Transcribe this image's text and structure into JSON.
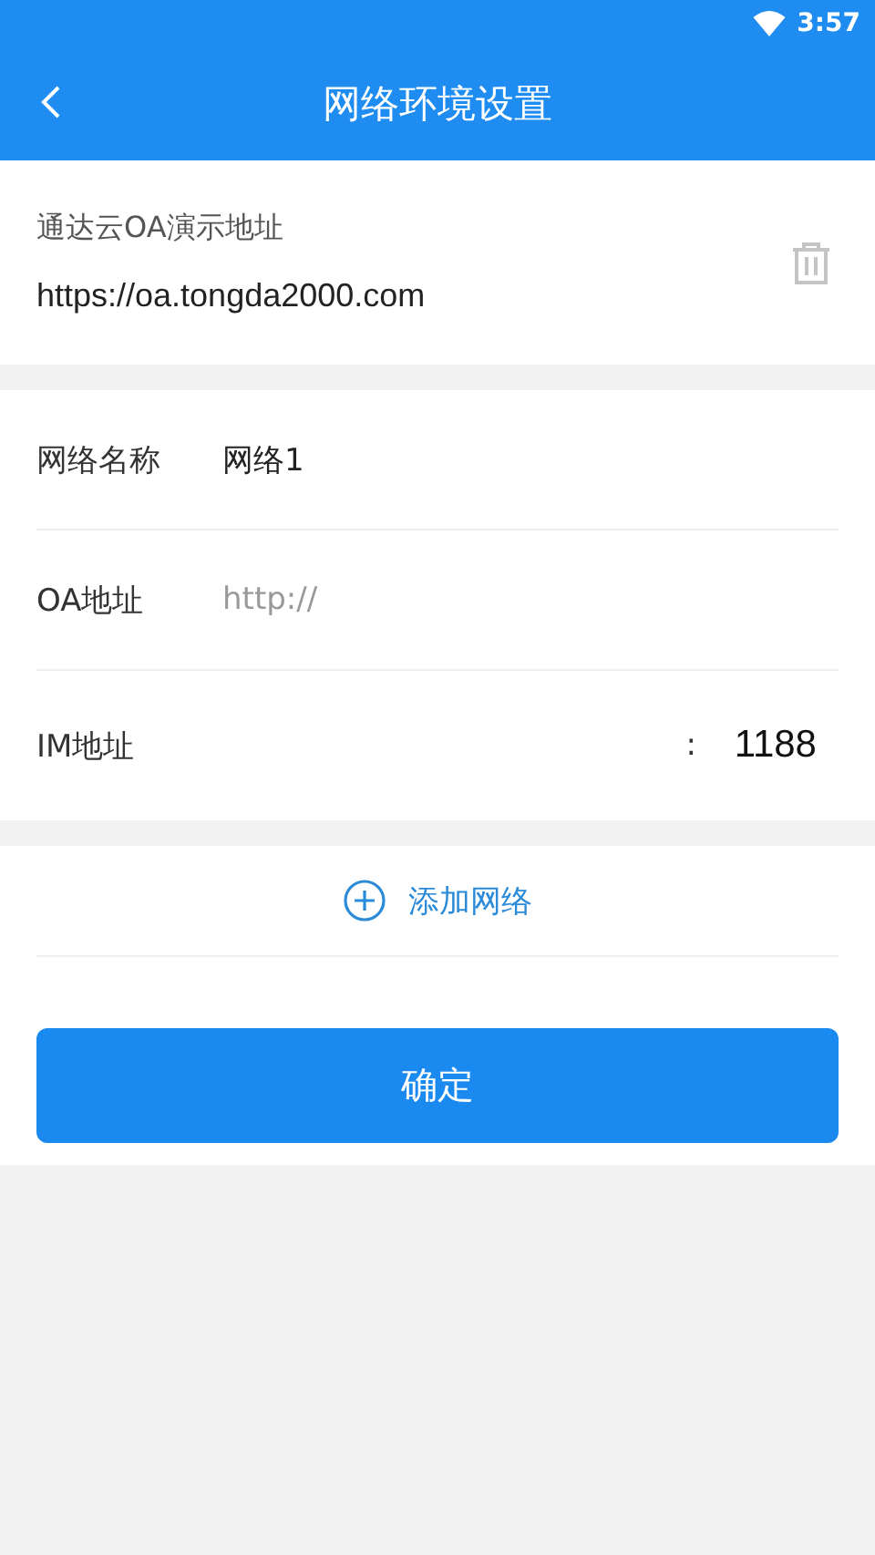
{
  "status_bar": {
    "time": "3:57"
  },
  "app_bar": {
    "title": "网络环境设置"
  },
  "saved_network": {
    "name": "通达云OA演示地址",
    "url": "https://oa.tongda2000.com"
  },
  "form": {
    "rows": [
      {
        "kind": "value",
        "label": "网络名称",
        "value": "网络1"
      },
      {
        "kind": "placeholder",
        "label": "OA地址",
        "placeholder": "http://"
      },
      {
        "kind": "port",
        "label": "IM地址",
        "separator": ":",
        "value": "1188"
      }
    ]
  },
  "add_network": {
    "label": "添加网络"
  },
  "confirm_button": {
    "label": "确定"
  }
}
